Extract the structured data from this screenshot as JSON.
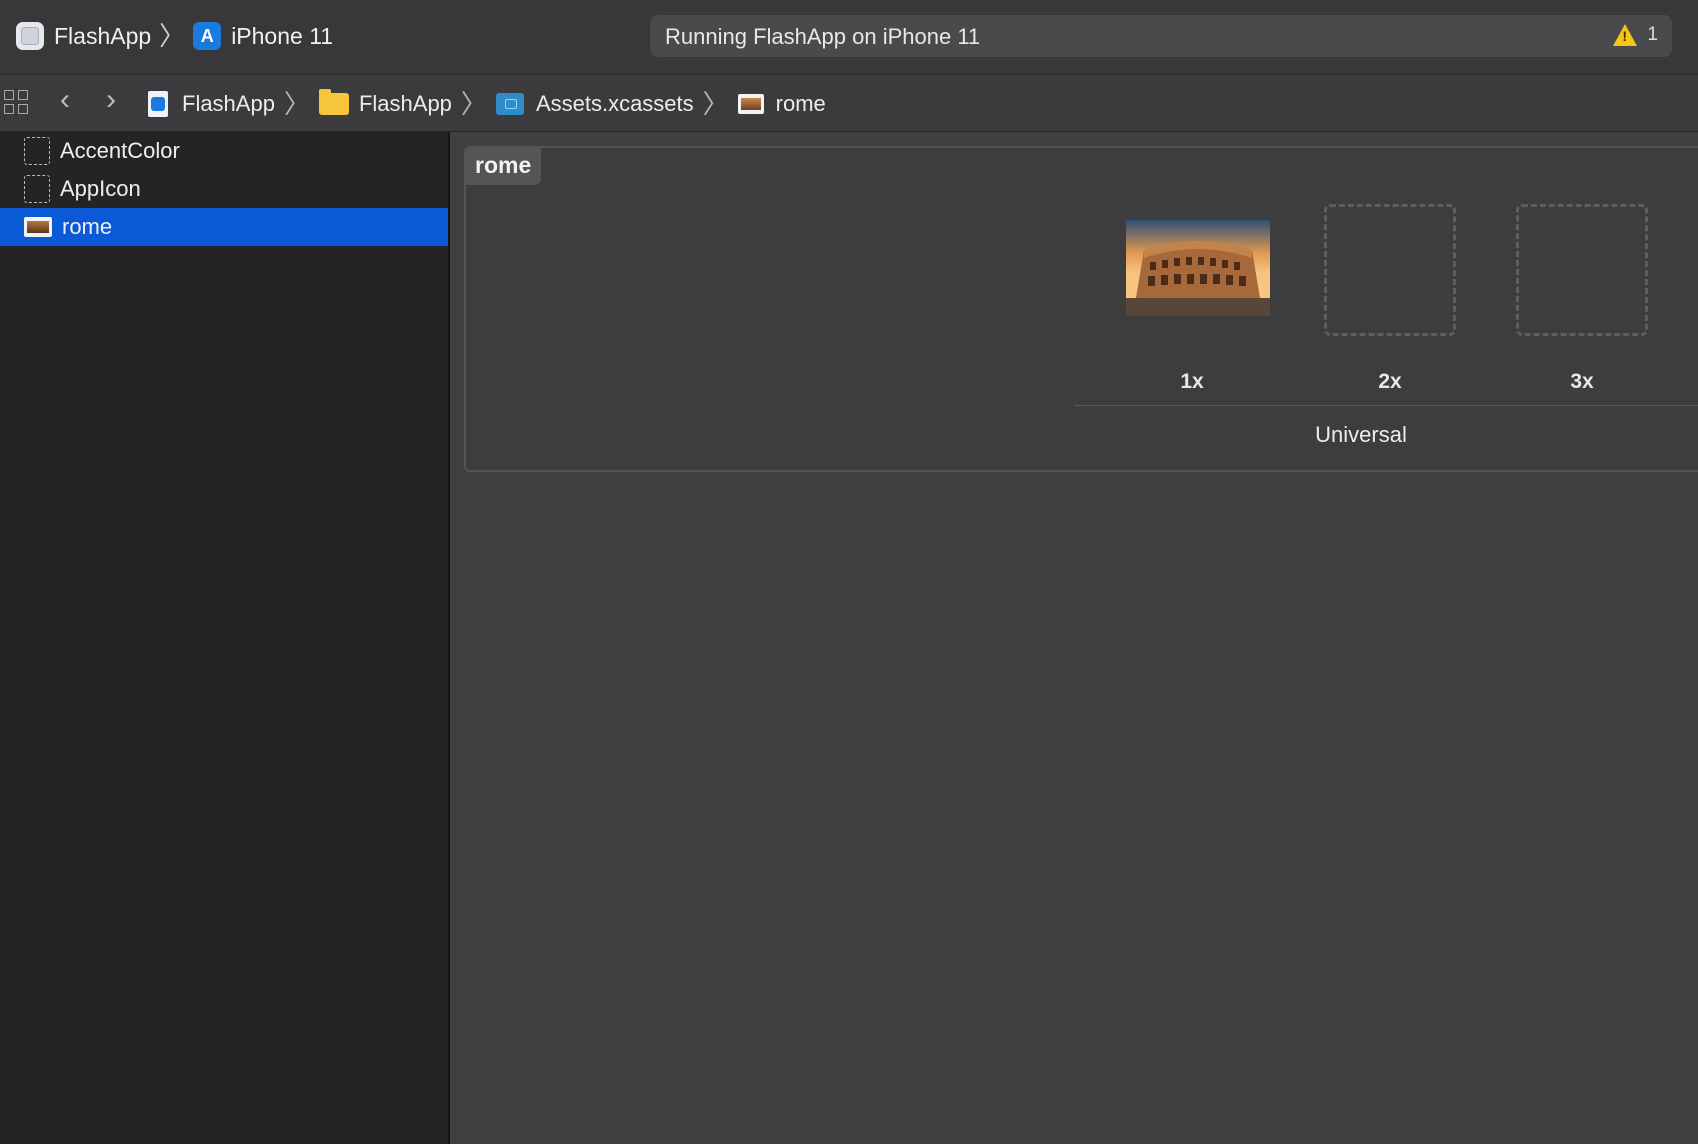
{
  "toolbar": {
    "scheme_app": "FlashApp",
    "scheme_device": "iPhone 11",
    "activity_text": "Running FlashApp on iPhone 11",
    "warning_count": "1"
  },
  "jumpbar": {
    "crumbs": [
      {
        "label": "FlashApp",
        "icon": "xcode-project-icon"
      },
      {
        "label": "FlashApp",
        "icon": "folder-icon"
      },
      {
        "label": "Assets.xcassets",
        "icon": "xcassets-icon"
      },
      {
        "label": "rome",
        "icon": "image-asset-icon"
      }
    ]
  },
  "sidebar": {
    "items": [
      {
        "label": "AccentColor",
        "icon": "color-set-icon"
      },
      {
        "label": "AppIcon",
        "icon": "app-icon-set-icon"
      },
      {
        "label": "rome",
        "icon": "image-set-icon",
        "selected": true
      }
    ]
  },
  "editor": {
    "set_name": "rome",
    "slots": [
      {
        "label": "1x",
        "filled": true
      },
      {
        "label": "2x",
        "filled": false
      },
      {
        "label": "3x",
        "filled": false
      }
    ],
    "group_label": "Universal"
  },
  "colors": {
    "selection": "#0b59d6",
    "warning": "#f5c518"
  }
}
